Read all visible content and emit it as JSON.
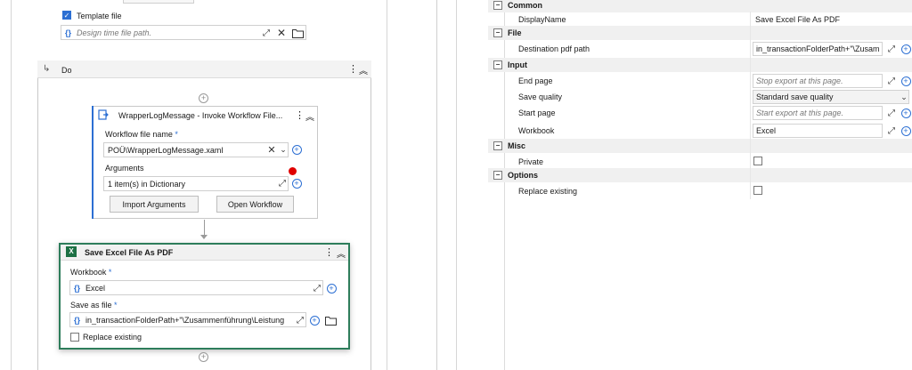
{
  "designer": {
    "template_file": {
      "label": "Template file",
      "checked": true,
      "placeholder": "Design time file path."
    },
    "do_sequence": {
      "label": "Do"
    },
    "invoke": {
      "title": "WrapperLogMessage - Invoke Workflow File...",
      "workflow_label": "Workflow file name",
      "workflow_required": "*",
      "workflow_value": "POÜ\\WrapperLogMessage.xaml",
      "arguments_label": "Arguments",
      "arguments_value": "1 item(s) in Dictionary",
      "import_button": "Import Arguments",
      "open_button": "Open Workflow"
    },
    "save_pdf": {
      "title": "Save Excel File As PDF",
      "workbook_label": "Workbook",
      "workbook_required": "*",
      "workbook_value": "Excel",
      "saveas_label": "Save as file",
      "saveas_required": "*",
      "saveas_value": "in_transactionFolderPath+\"\\Zusammenführung\\Leistung",
      "replace_label": "Replace existing",
      "replace_checked": false
    },
    "colors": {
      "accent": "#2c6fd3",
      "selected_border": "#2e7d5b",
      "error_dot": "#e00000"
    }
  },
  "properties": {
    "categories": [
      {
        "name": "Common",
        "rows": [
          {
            "name": "DisplayName",
            "value": "Save Excel File As PDF",
            "kind": "plain"
          }
        ]
      },
      {
        "name": "File",
        "rows": [
          {
            "name": "Destination pdf path",
            "value": "in_transactionFolderPath+\"\\Zusam",
            "kind": "expr"
          }
        ]
      },
      {
        "name": "Input",
        "rows": [
          {
            "name": "End page",
            "value": "Stop export at this page.",
            "kind": "placeholder"
          },
          {
            "name": "Save quality",
            "value": "Standard save quality",
            "kind": "select"
          },
          {
            "name": "Start page",
            "value": "Start export at this page.",
            "kind": "placeholder"
          },
          {
            "name": "Workbook",
            "value": "Excel",
            "kind": "expr"
          }
        ]
      },
      {
        "name": "Misc",
        "rows": [
          {
            "name": "Private",
            "value": "",
            "kind": "checkbox"
          }
        ]
      },
      {
        "name": "Options",
        "rows": [
          {
            "name": "Replace existing",
            "value": "",
            "kind": "checkbox"
          }
        ]
      }
    ],
    "toggle_symbol": "−"
  }
}
